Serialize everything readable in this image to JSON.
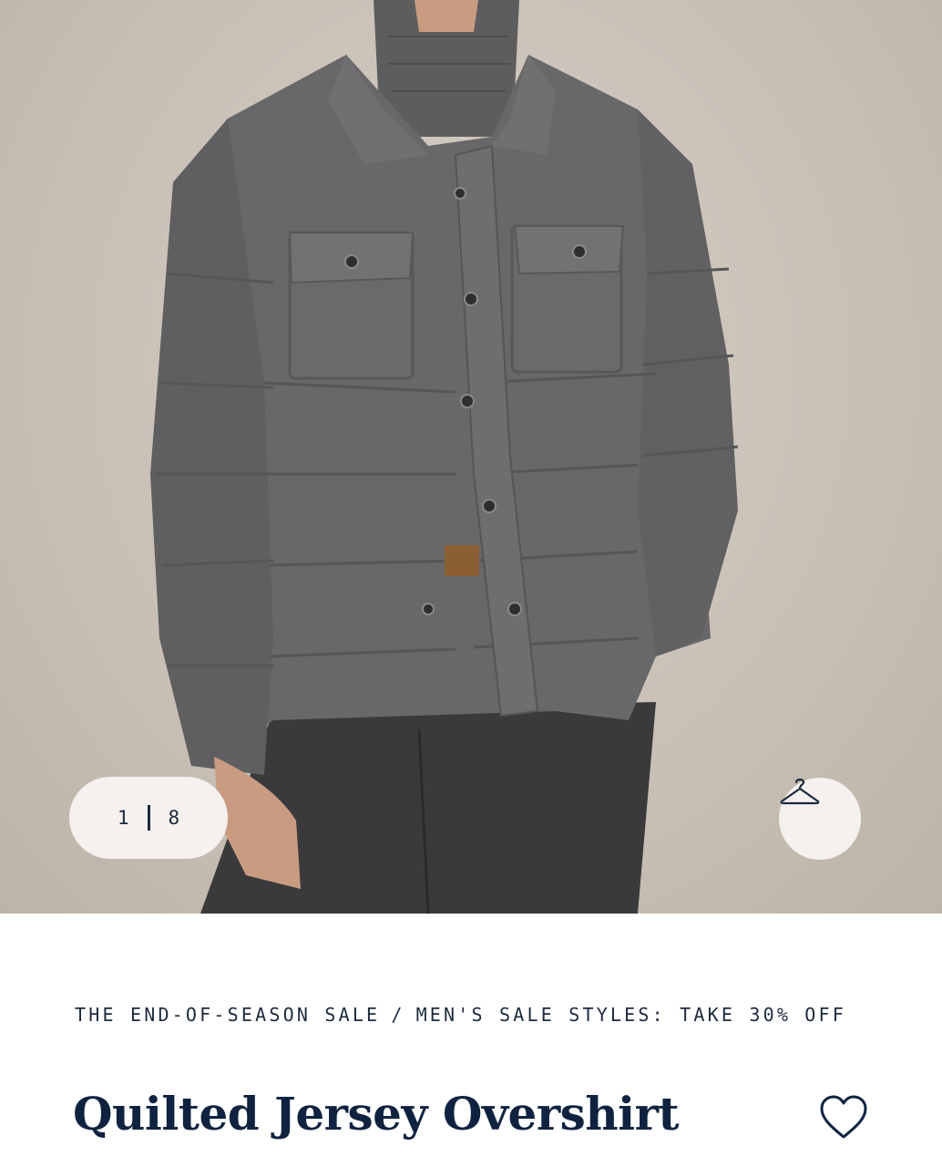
{
  "gallery": {
    "current": "1",
    "total": "8",
    "hanger_icon": "hanger-icon"
  },
  "breadcrumb": {
    "category": "THE END-OF-SEASON SALE",
    "separator": "/",
    "subcategory": "MEN'S SALE STYLES: TAKE 30% OFF"
  },
  "product": {
    "title": "Quilted Jersey Overshirt",
    "favorite_icon": "heart-icon"
  },
  "colors": {
    "text_navy": "#0f2340",
    "pill_bg": "#f4f1ee"
  }
}
